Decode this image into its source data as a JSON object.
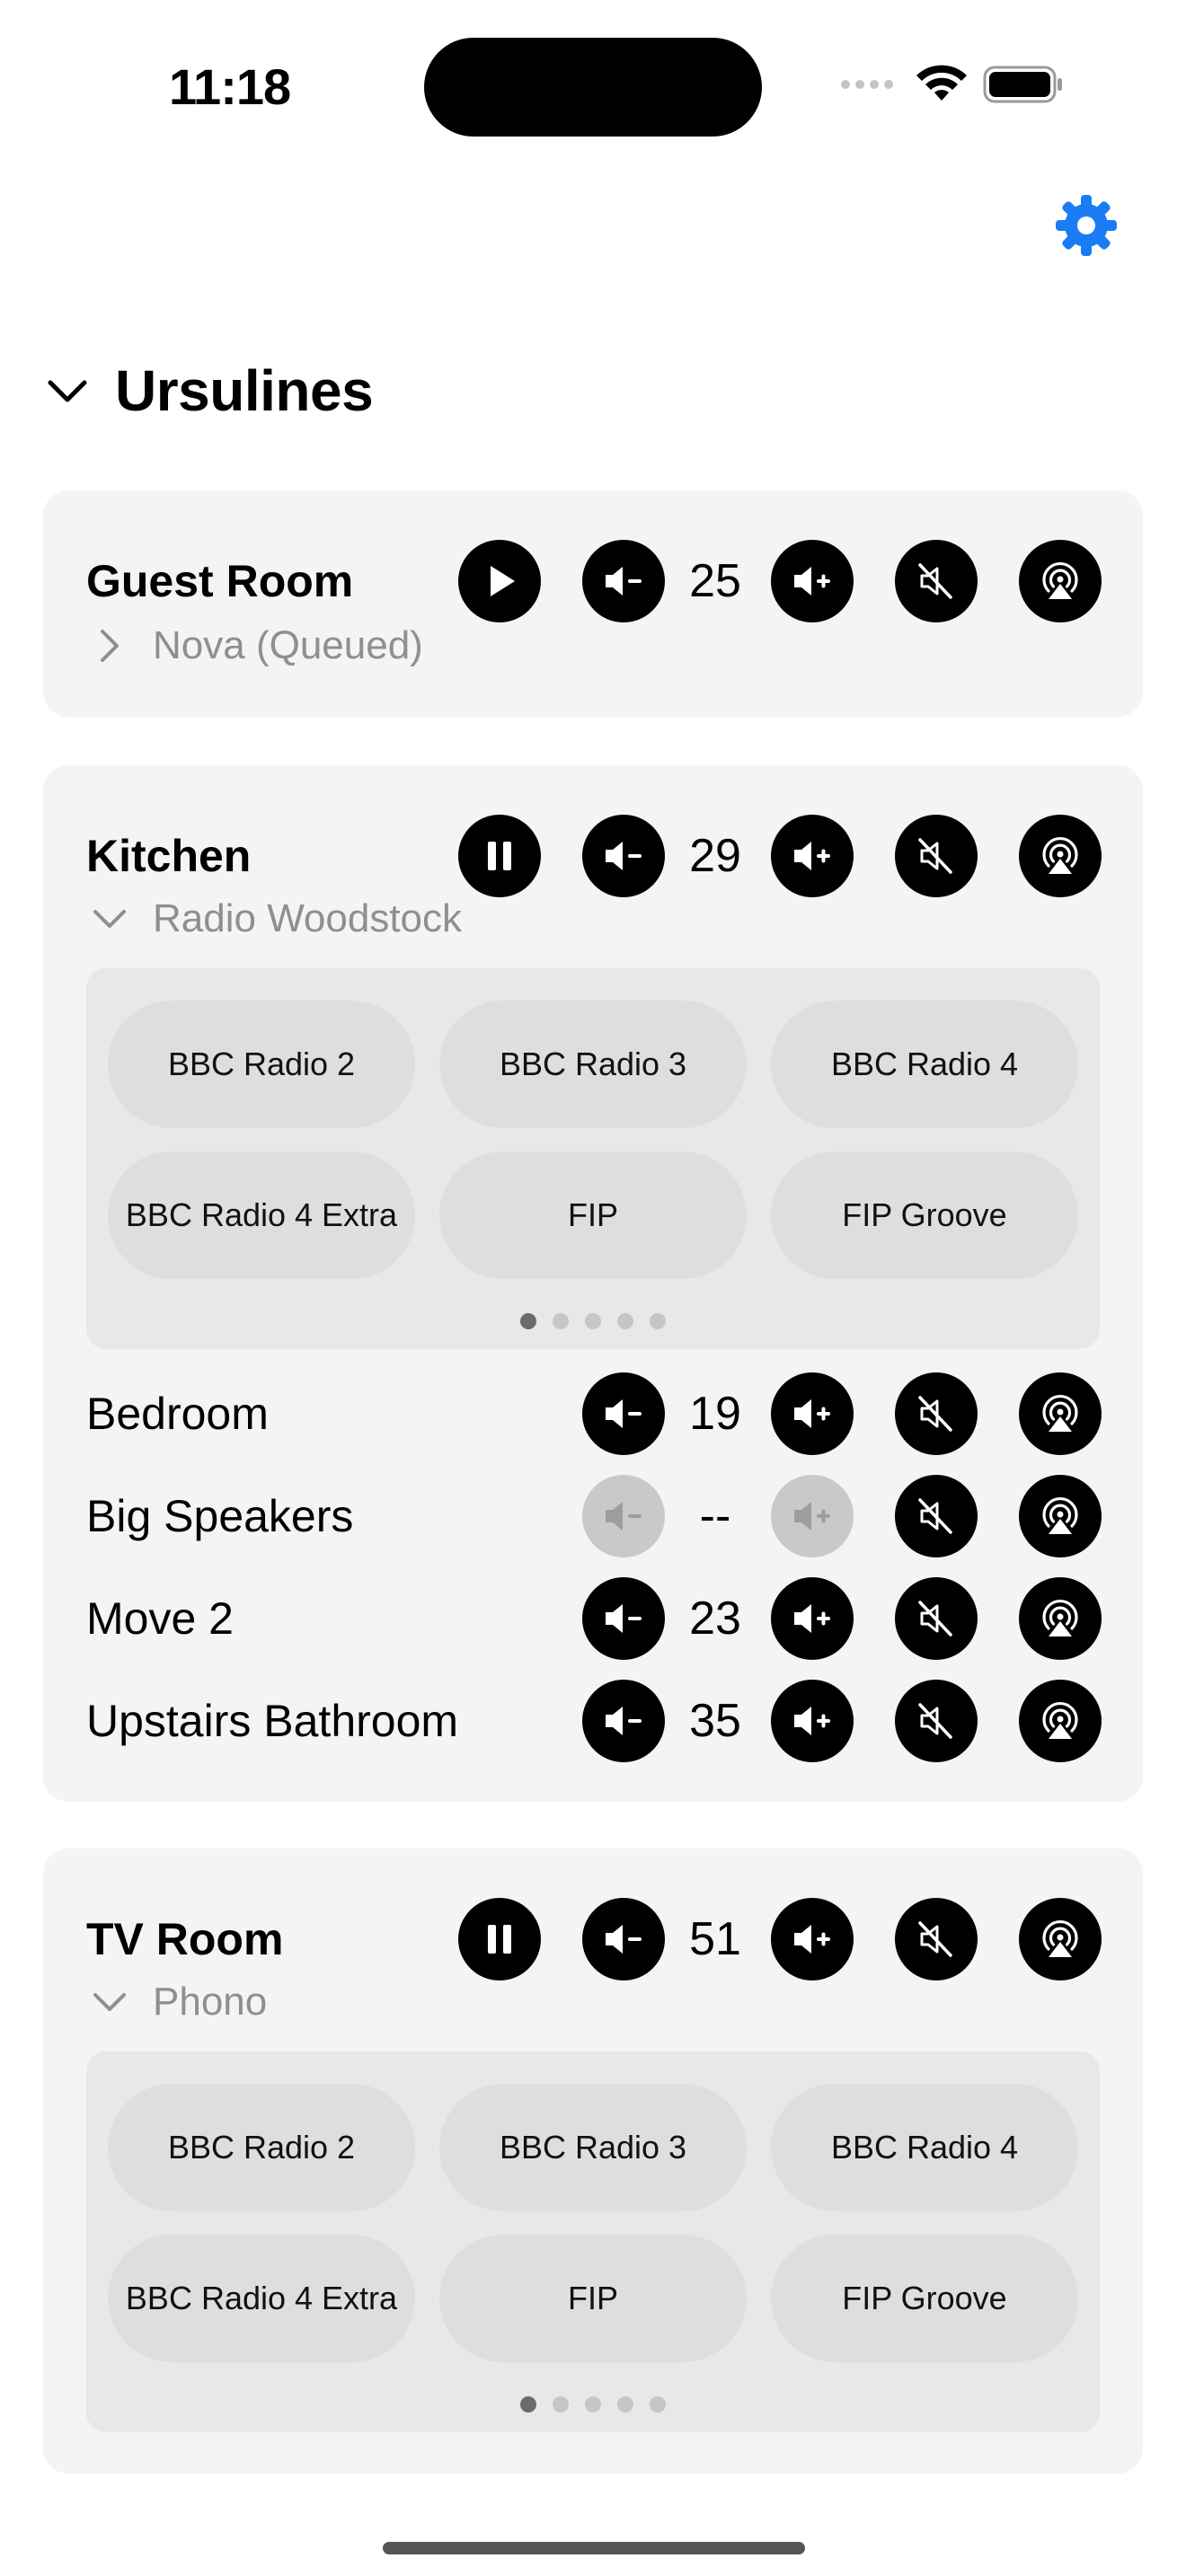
{
  "status_bar": {
    "time": "11:18"
  },
  "accent_color": "#1a7cf5",
  "section": {
    "title": "Ursulines"
  },
  "guest_room": {
    "name": "Guest Room",
    "volume": "25",
    "play_icon": "play-icon",
    "now_playing": "Nova (Queued)"
  },
  "kitchen": {
    "name": "Kitchen",
    "volume": "29",
    "play_icon": "pause-icon",
    "now_playing": "Radio Woodstock",
    "presets": [
      "BBC Radio 2",
      "BBC Radio 3",
      "BBC Radio 4",
      "BBC Radio 4 Extra",
      "FIP",
      "FIP Groove"
    ],
    "page_count": 5,
    "active_page": 1,
    "grouped": [
      {
        "name": "Bedroom",
        "volume": "19"
      },
      {
        "name": "Big Speakers",
        "volume": "--"
      },
      {
        "name": "Move 2",
        "volume": "23"
      },
      {
        "name": "Upstairs Bathroom",
        "volume": "35"
      }
    ]
  },
  "tv_room": {
    "name": "TV Room",
    "volume": "51",
    "play_icon": "pause-icon",
    "now_playing": "Phono",
    "presets": [
      "BBC Radio 2",
      "BBC Radio 3",
      "BBC Radio 4",
      "BBC Radio 4 Extra",
      "FIP",
      "FIP Groove"
    ],
    "page_count": 5,
    "active_page": 1
  }
}
